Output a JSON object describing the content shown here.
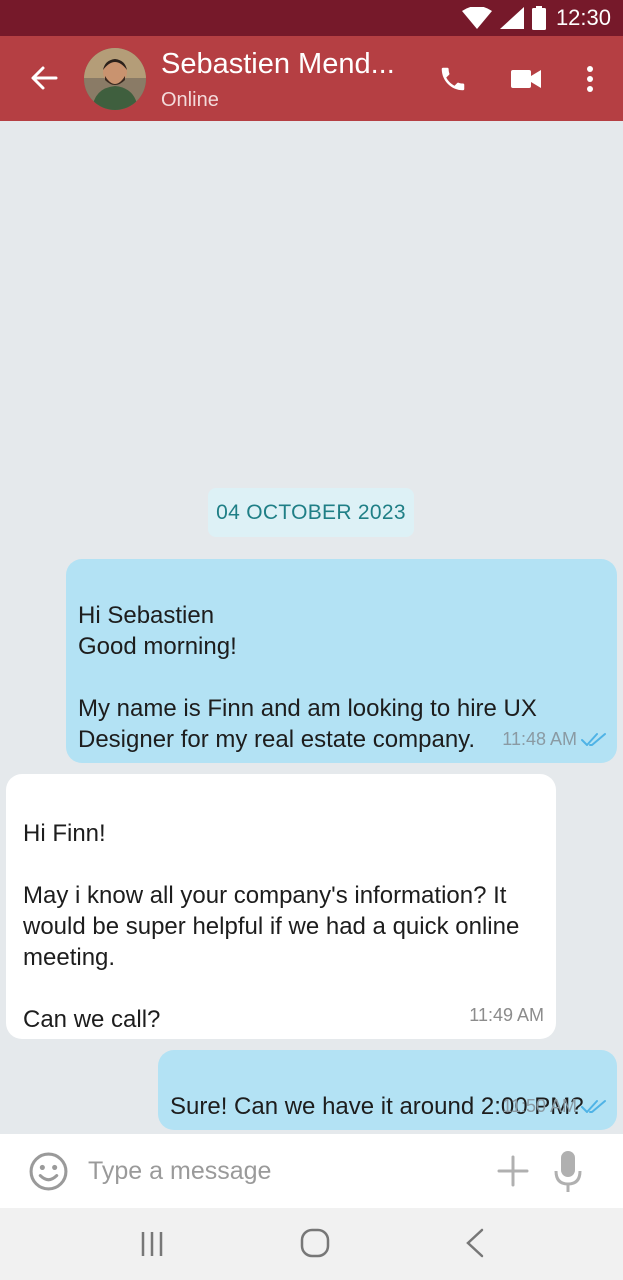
{
  "status_bar": {
    "time": "12:30",
    "icons": [
      "wifi-icon",
      "signal-icon",
      "battery-icon"
    ]
  },
  "header": {
    "contact_name": "Sebastien Mend...",
    "presence": "Online",
    "icons": [
      "back-arrow-icon",
      "phone-icon",
      "video-camera-icon",
      "more-vert-icon"
    ]
  },
  "chat": {
    "date_label": "04 OCTOBER 2023",
    "messages": [
      {
        "direction": "outgoing",
        "text": "Hi Sebastien\nGood morning!\n\nMy name is Finn and am looking to hire UX Designer for my real estate company.",
        "time": "11:48 AM",
        "status": "read"
      },
      {
        "direction": "incoming",
        "text": "Hi Finn!\n\nMay i know all your company's information? It would be super helpful if we had a quick online meeting.\n\nCan we call?",
        "time": "11:49 AM"
      },
      {
        "direction": "outgoing",
        "text": "Sure! Can we have it around 2:00 PM?",
        "time": "11:50 AM",
        "status": "read"
      }
    ]
  },
  "composer": {
    "placeholder": "Type a message",
    "icons": [
      "emoji-icon",
      "plus-icon",
      "microphone-icon"
    ]
  },
  "nav_bar": {
    "icons": [
      "recents-icon",
      "home-icon",
      "back-icon"
    ]
  },
  "colors": {
    "status_bar": "#76192a",
    "app_bar": "#b53f43",
    "chat_background": "#e5e9ec",
    "outgoing_bubble": "#b3e2f4",
    "incoming_bubble": "#ffffff",
    "date_chip": "#ddf1f6",
    "read_ticks": "#4fb3e6"
  }
}
